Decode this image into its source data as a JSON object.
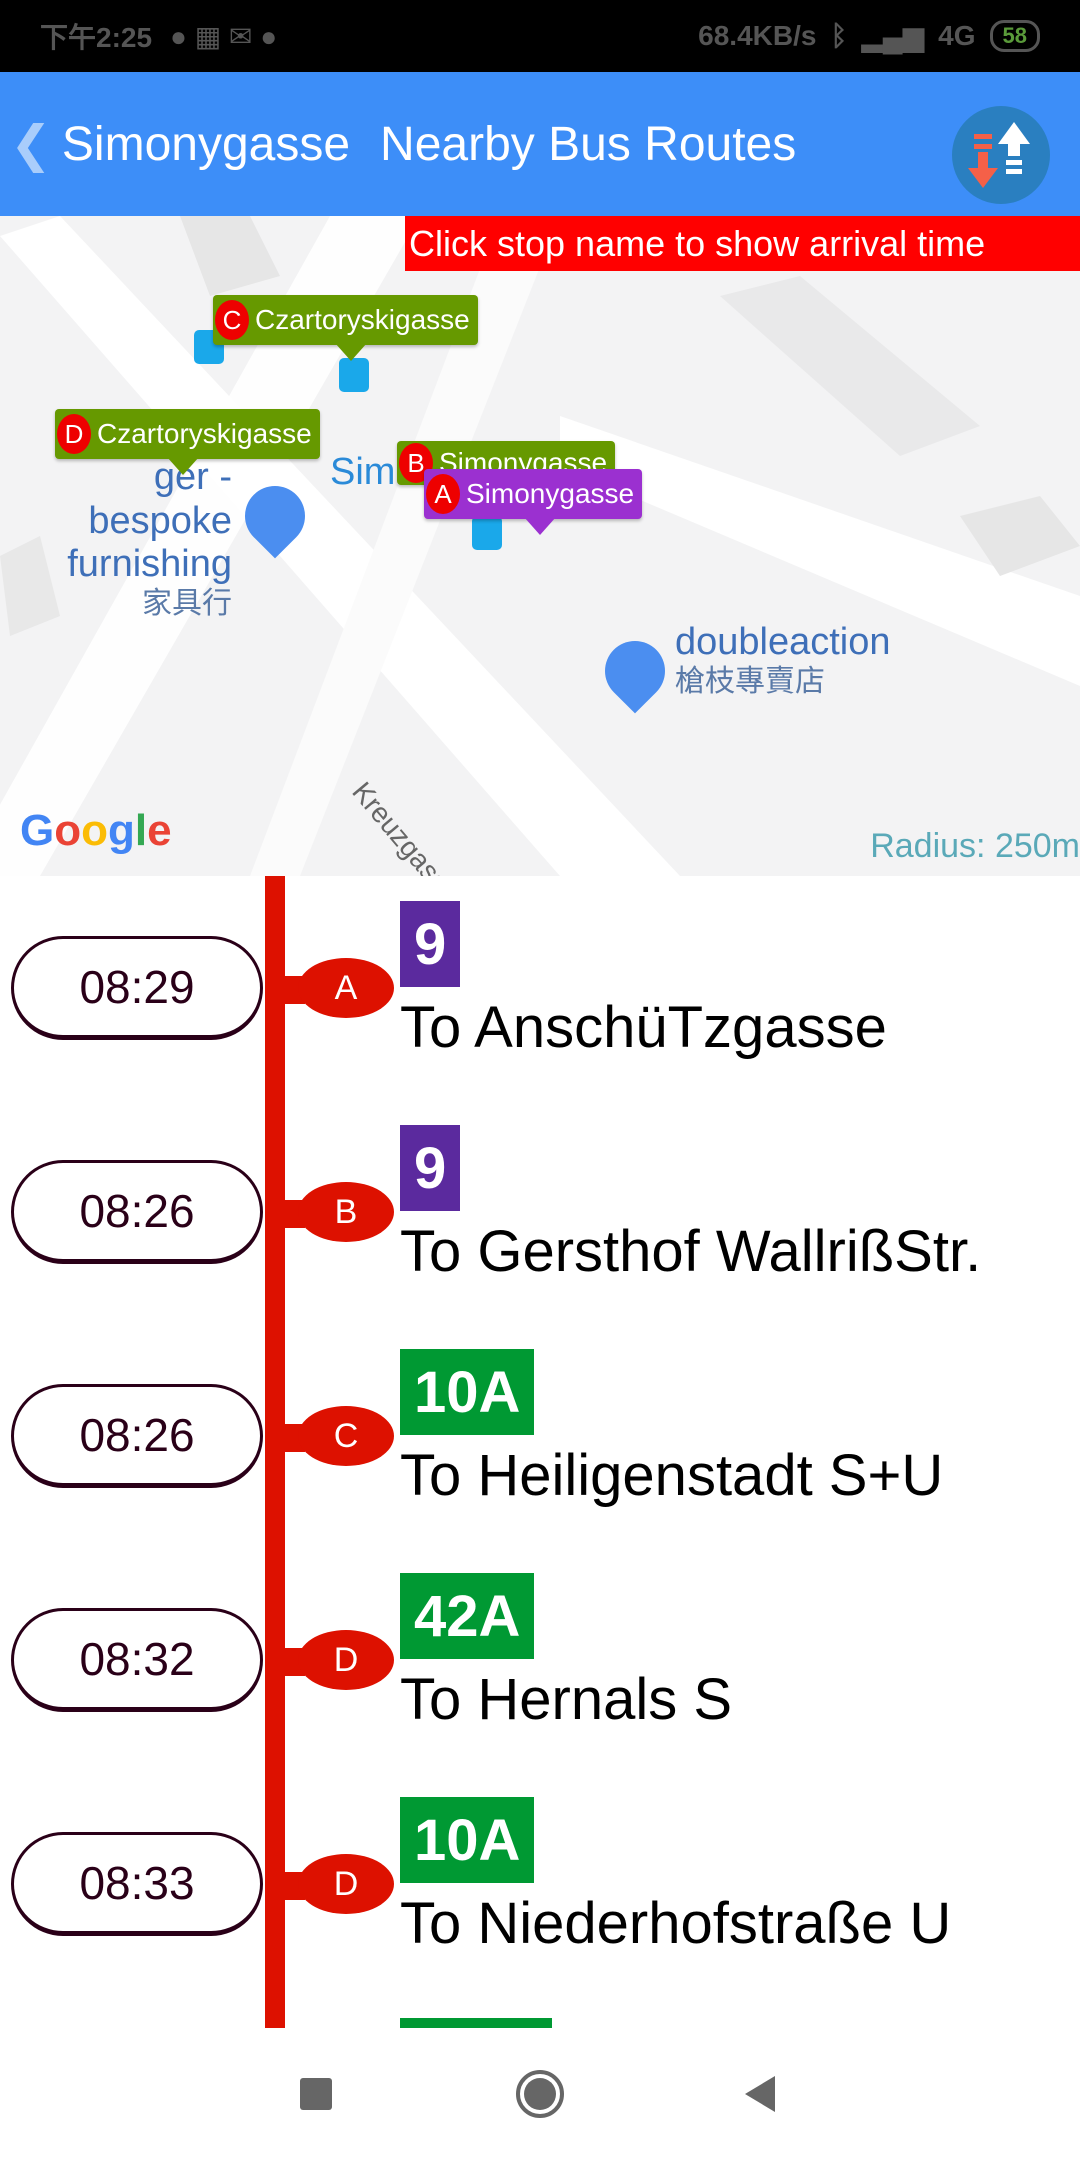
{
  "status_bar": {
    "time": "下午2:25",
    "speed": "68.4KB/s",
    "network": "4G",
    "battery": "58"
  },
  "header": {
    "stop_name": "Simonygasse",
    "title": "Nearby Bus Routes",
    "back_icon": "chevron-left-icon",
    "sort_icon": "sort-arrows-icon"
  },
  "map": {
    "banner": "Click stop name to show arrival time",
    "radius": "Radius: 250m",
    "logo": "Google",
    "markers": [
      {
        "letter": "C",
        "name": "Czartoryskigasse",
        "color": "#669900"
      },
      {
        "letter": "D",
        "name": "Czartoryskigasse",
        "color": "#669900"
      },
      {
        "letter": "B",
        "name": "Simonygasse",
        "color": "#669900"
      },
      {
        "letter": "A",
        "name": "Simonygasse",
        "color": "#9b30d0"
      }
    ],
    "pois": [
      {
        "name": "ger - bespoke furnishing",
        "sub": "家具行"
      },
      {
        "name": "doubleaction",
        "sub": "槍枝專賣店"
      }
    ],
    "street": "Kreuzgasse",
    "partial_label": "Sim"
  },
  "arrivals": [
    {
      "time": "08:29",
      "stop": "A",
      "route": "9",
      "route_color": "#5b2a9e",
      "destination": "To AnschüTzgasse"
    },
    {
      "time": "08:26",
      "stop": "B",
      "route": "9",
      "route_color": "#5b2a9e",
      "destination": "To Gersthof WallrißStr."
    },
    {
      "time": "08:26",
      "stop": "C",
      "route": "10A",
      "route_color": "#009933",
      "destination": "To Heiligenstadt S+U"
    },
    {
      "time": "08:32",
      "stop": "D",
      "route": "42A",
      "route_color": "#009933",
      "destination": "To Hernals S"
    },
    {
      "time": "08:33",
      "stop": "D",
      "route": "10A",
      "route_color": "#009933",
      "destination": "To Niederhofstraße U"
    }
  ],
  "colors": {
    "header": "#3d8ef8",
    "rail": "#dd1100",
    "banner": "#ff0000"
  }
}
